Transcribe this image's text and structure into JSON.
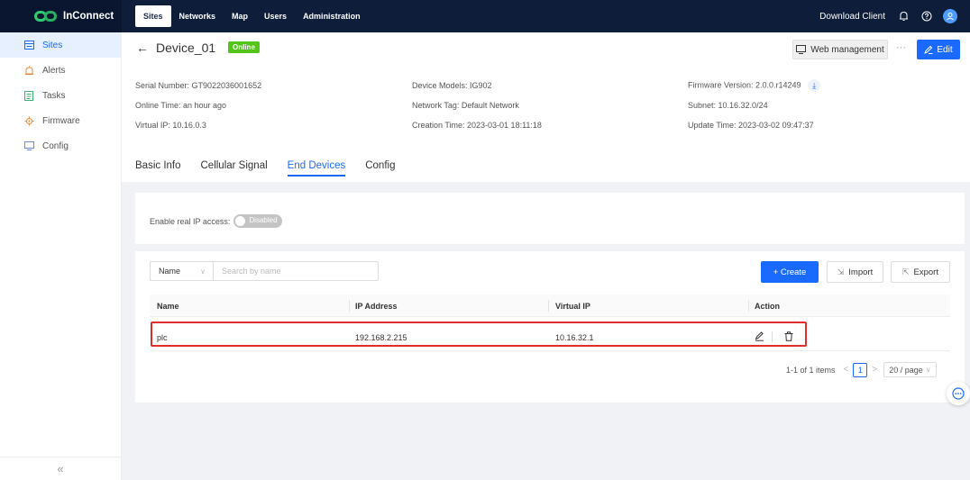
{
  "app": {
    "name": "InConnect"
  },
  "topnav": {
    "items": [
      {
        "label": "Sites",
        "active": true
      },
      {
        "label": "Networks"
      },
      {
        "label": "Map"
      },
      {
        "label": "Users"
      },
      {
        "label": "Administration"
      }
    ],
    "download_label": "Download Client",
    "icons": [
      "bell-icon",
      "help-icon",
      "user-avatar"
    ]
  },
  "sidebar": {
    "items": [
      {
        "label": "Sites",
        "icon": "sites-icon",
        "active": true
      },
      {
        "label": "Alerts",
        "icon": "alert-icon"
      },
      {
        "label": "Tasks",
        "icon": "tasks-icon"
      },
      {
        "label": "Firmware",
        "icon": "firmware-icon"
      },
      {
        "label": "Config",
        "icon": "config-icon"
      }
    ],
    "collapse_label": "«"
  },
  "device": {
    "back_icon": "←",
    "title": "Device_01",
    "status": "Online",
    "web_management_label": "Web management",
    "more_label": "···",
    "edit_label": "Edit",
    "info": {
      "serial": "Serial Number: GT9022036001652",
      "online_time": "Online Time: an hour ago",
      "virtual_ip": "Virtual IP: 10.16.0.3",
      "model": "Device Models: IG902",
      "network_tag": "Network Tag: Default Network",
      "creation_time": "Creation Time: 2023-03-01 18:11:18",
      "firmware": "Firmware Version: 2.0.0.r14249",
      "subnet": "Subnet: 10.16.32.0/24",
      "update_time": "Update Time: 2023-03-02 09:47:37"
    },
    "tabs": [
      {
        "label": "Basic Info"
      },
      {
        "label": "Cellular Signal"
      },
      {
        "label": "End Devices",
        "active": true
      },
      {
        "label": "Config"
      }
    ]
  },
  "real_ip": {
    "label": "Enable real IP access:",
    "toggle_label": "Disabled",
    "enabled": false
  },
  "toolbar": {
    "filter_field": "Name",
    "search_placeholder": "Search by name",
    "create_label": "+ Create",
    "import_label": "Import",
    "export_label": "Export"
  },
  "table": {
    "columns": [
      "Name",
      "IP Address",
      "Virtual IP",
      "Action"
    ],
    "rows": [
      {
        "name": "plc",
        "ip": "192.168.2.215",
        "virtual_ip": "10.16.32.1"
      }
    ]
  },
  "pagination": {
    "summary": "1-1 of 1 items",
    "prev": "<",
    "current_page": "1",
    "next": ">",
    "page_size": "20 / page"
  },
  "colors": {
    "primary": "#1a6aff",
    "topbar": "#0d1d3a",
    "online_badge": "#52c41a",
    "highlight": "#e02e2e"
  }
}
